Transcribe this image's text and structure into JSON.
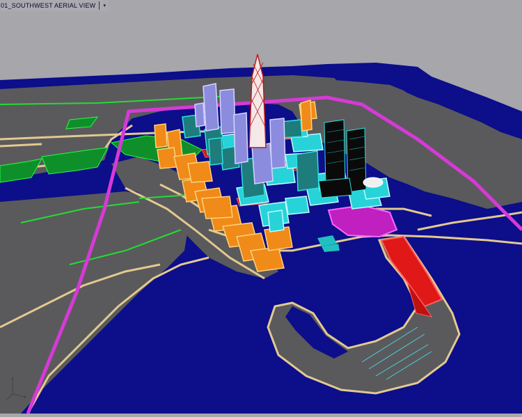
{
  "viewport": {
    "view_name": "01_SOUTHWEST AERIAL VIEW",
    "dropdown_icon": "chevron-down-icon",
    "ucs_icon": "ucs-axis-icon"
  },
  "colors": {
    "background": "#a6a6ab",
    "water": "#0c0e8a",
    "land": "#5a5a5c",
    "road": "#e3c98f",
    "green": "#0f8f2a",
    "boundary": "#d63ad6",
    "orange_blocks": "#f08a18",
    "cyan_blocks": "#27d3d8",
    "lavender_towers": "#8c8cde",
    "teal_towers": "#1e7c7c",
    "red_blocks": "#e01818",
    "magenta_blocks": "#c020c0",
    "black_towers": "#0a0a0a"
  }
}
